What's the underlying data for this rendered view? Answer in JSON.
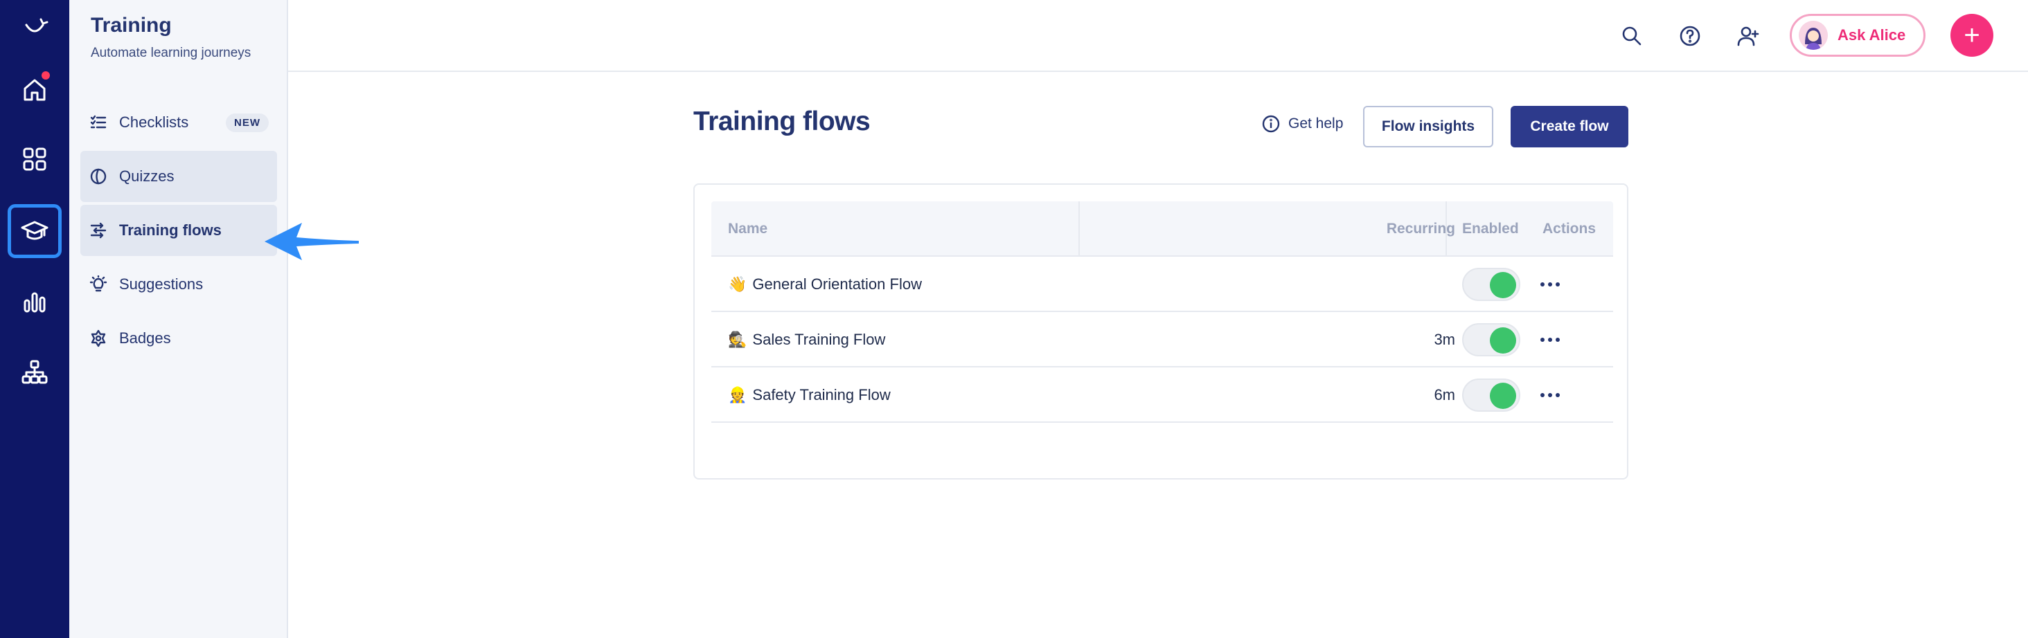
{
  "rail": {
    "items": [
      {
        "icon": "logo-icon"
      },
      {
        "icon": "home-icon",
        "has_notification": true
      },
      {
        "icon": "apps-grid-icon"
      },
      {
        "icon": "graduation-cap-icon",
        "selected": true
      },
      {
        "icon": "bar-chart-icon"
      },
      {
        "icon": "org-chart-icon"
      }
    ]
  },
  "sidebar": {
    "title": "Training",
    "subtitle": "Automate learning journeys",
    "items": [
      {
        "label": "Checklists",
        "icon": "checklist-icon",
        "badge": "NEW"
      },
      {
        "label": "Quizzes",
        "icon": "quiz-icon"
      },
      {
        "label": "Training flows",
        "icon": "flows-icon",
        "active": true
      },
      {
        "label": "Suggestions",
        "icon": "lightbulb-icon"
      },
      {
        "label": "Badges",
        "icon": "badge-icon"
      }
    ]
  },
  "topbar": {
    "ask_label": "Ask Alice",
    "plus_label": "+"
  },
  "main": {
    "title": "Training flows",
    "get_help": "Get help",
    "flow_insights": "Flow insights",
    "create_flow": "Create flow",
    "table": {
      "headers": {
        "name": "Name",
        "recurring": "Recurring",
        "enabled": "Enabled",
        "actions": "Actions"
      },
      "rows": [
        {
          "emoji": "👋",
          "name": "General Orientation Flow",
          "recurring": "",
          "enabled": true
        },
        {
          "emoji": "🕵",
          "name": "Sales Training Flow",
          "recurring": "3m",
          "enabled": true
        },
        {
          "emoji": "👷",
          "name": "Safety Training Flow",
          "recurring": "6m",
          "enabled": true
        }
      ]
    }
  },
  "colors": {
    "rail_bg": "#0e1766",
    "primary": "#2d3a8c",
    "accent_pink": "#f5307c",
    "toggle_on": "#3cc46b",
    "annotation_blue": "#2f8cf7"
  }
}
